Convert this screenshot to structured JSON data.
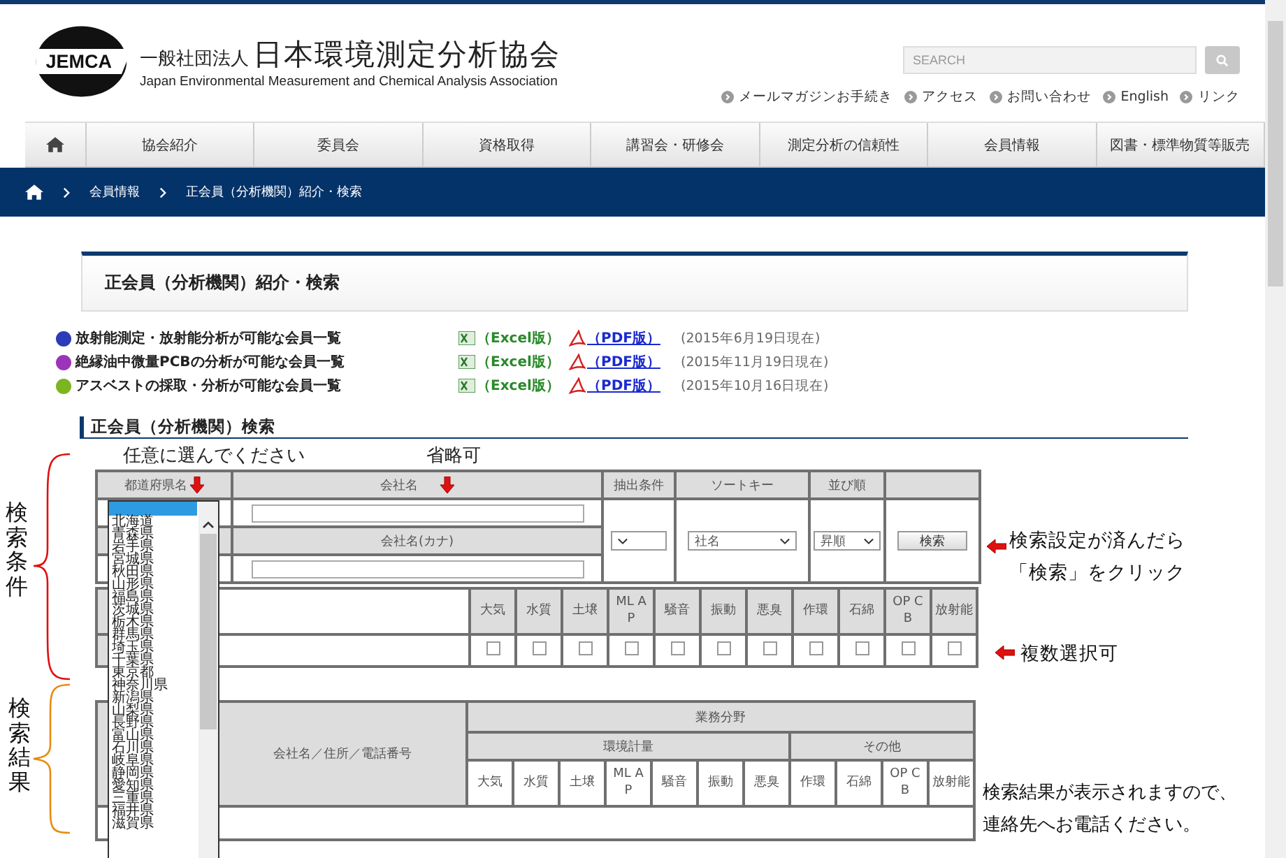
{
  "header": {
    "logo_text": "JEMCA",
    "org_prefix": "一般社団法人",
    "org_name": "日本環境測定分析協会",
    "org_name_en": "Japan Environmental Measurement and Chemical Analysis Association",
    "search": {
      "placeholder": "SEARCH"
    },
    "links": [
      "メールマガジンお手続き",
      "アクセス",
      "お問い合わせ",
      "English",
      "リンク"
    ]
  },
  "nav": {
    "items": [
      "協会紹介",
      "委員会",
      "資格取得",
      "講習会・研修会",
      "測定分析の信頼性",
      "会員情報",
      "図書・標準物質等販売"
    ]
  },
  "breadcrumb": [
    "会員情報",
    "正会員（分析機関）紹介・検索"
  ],
  "page_title": "正会員（分析機関）紹介・検索",
  "downloads": [
    {
      "label": "放射能測定・放射能分析が可能な会員一覧",
      "color": "#2b3cb8",
      "excel": "（Excel版）",
      "pdf": "（PDF版）",
      "date": "(2015年6月19日現在)"
    },
    {
      "label": "絶縁油中微量PCBの分析が可能な会員一覧",
      "color": "#9b34bb",
      "excel": "（Excel版）",
      "pdf": "（PDF版）",
      "date": "(2015年11月19日現在)"
    },
    {
      "label": "アスベストの採取・分析が可能な会員一覧",
      "color": "#7bb620",
      "excel": "（Excel版）",
      "pdf": "（PDF版）",
      "date": "(2015年10月16日現在)"
    }
  ],
  "search_section": {
    "heading": "正会員（分析機関）検索",
    "headers": {
      "prefecture": "都道府県名",
      "company": "会社名",
      "company_kana": "会社名(カナ)",
      "filter": "抽出条件",
      "sort_key": "ソートキー",
      "order": "並び順"
    },
    "sort_value": "社名",
    "order_value": "昇順",
    "search_button": "検索",
    "categories": [
      {
        "label": "大気",
        "checked": false
      },
      {
        "label": "水質",
        "checked": false
      },
      {
        "label": "土壌",
        "checked": false
      },
      {
        "label": "ML AP",
        "checked": false
      },
      {
        "label": "騒音",
        "checked": false
      },
      {
        "label": "振動",
        "checked": false
      },
      {
        "label": "悪臭",
        "checked": false
      },
      {
        "label": "作環",
        "checked": false
      },
      {
        "label": "石綿",
        "checked": false
      },
      {
        "label": "OP CB",
        "checked": false
      },
      {
        "label": "放射能",
        "checked": false
      }
    ]
  },
  "results_table": {
    "company_header": "会社名／住所／電話番号",
    "group_header": "業務分野",
    "subgroups": [
      {
        "label": "環境計量"
      },
      {
        "label": "その他"
      }
    ],
    "categories": [
      "大気",
      "水質",
      "土壌",
      "ML AP",
      "騒音",
      "振動",
      "悪臭",
      "作環",
      "石綿",
      "OP CB",
      "放射能"
    ]
  },
  "prefecture_list": {
    "blank_selected": true,
    "items": [
      {
        "label": "北海道",
        "selected": false
      },
      {
        "label": "青森県",
        "selected": false
      },
      {
        "label": "岩手県",
        "selected": false
      },
      {
        "label": "宮城県",
        "selected": false
      },
      {
        "label": "秋田県",
        "selected": false
      },
      {
        "label": "山形県",
        "selected": false
      },
      {
        "label": "福島県",
        "selected": false
      },
      {
        "label": "茨城県",
        "selected": false
      },
      {
        "label": "栃木県",
        "selected": false
      },
      {
        "label": "群馬県",
        "selected": false
      },
      {
        "label": "埼玉県",
        "selected": false
      },
      {
        "label": "千葉県",
        "selected": false
      },
      {
        "label": "東京都",
        "selected": false
      },
      {
        "label": "神奈川県",
        "selected": false
      },
      {
        "label": "新潟県",
        "selected": false
      },
      {
        "label": "山梨県",
        "selected": false
      },
      {
        "label": "長野県",
        "selected": false
      },
      {
        "label": "富山県",
        "selected": false
      },
      {
        "label": "石川県",
        "selected": false
      },
      {
        "label": "岐阜県",
        "selected": false
      },
      {
        "label": "静岡県",
        "selected": false
      },
      {
        "label": "愛知県",
        "selected": false
      },
      {
        "label": "三重県",
        "selected": false
      },
      {
        "label": "福井県",
        "selected": false
      },
      {
        "label": "滋賀県",
        "selected": false
      }
    ]
  },
  "annotations": {
    "pick_hint": "任意に選んでください",
    "optional_hint": "省略可",
    "conditions_label": "検索条件",
    "results_label": "検索結果",
    "search_hint": [
      "検索設定が済んだら",
      "「検索」をクリック"
    ],
    "multi_hint": "複数選択可",
    "result_hint": [
      "検索結果が表示されますので、",
      "連絡先へお電話ください。"
    ]
  }
}
